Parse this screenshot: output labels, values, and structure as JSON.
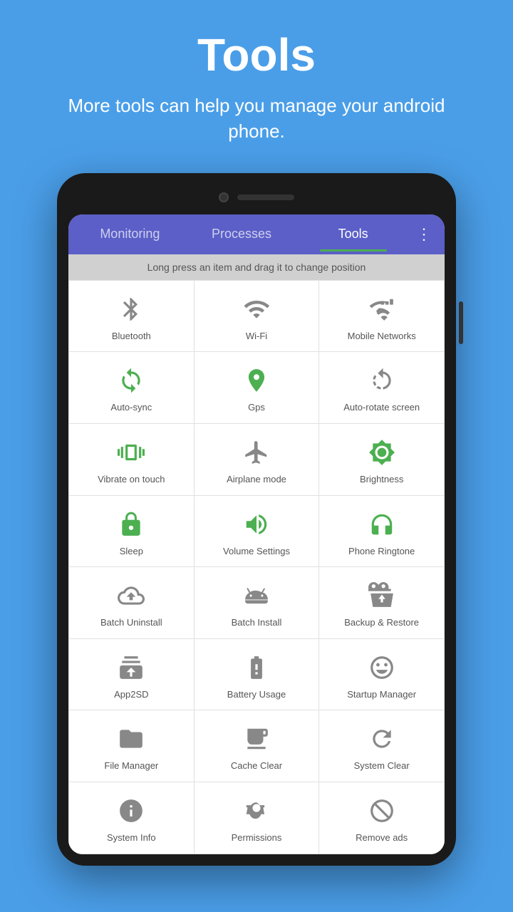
{
  "header": {
    "title": "Tools",
    "subtitle": "More tools can help you manage your android phone."
  },
  "tabs": {
    "items": [
      {
        "label": "Monitoring",
        "active": false
      },
      {
        "label": "Processes",
        "active": false
      },
      {
        "label": "Tools",
        "active": true
      }
    ],
    "more_icon": "⋮"
  },
  "hint": {
    "text": "Long press an item and drag it to change position"
  },
  "tools": [
    {
      "id": "bluetooth",
      "label": "Bluetooth",
      "color": "gray"
    },
    {
      "id": "wifi",
      "label": "Wi-Fi",
      "color": "gray"
    },
    {
      "id": "mobile-networks",
      "label": "Mobile Networks",
      "color": "gray"
    },
    {
      "id": "auto-sync",
      "label": "Auto-sync",
      "color": "green"
    },
    {
      "id": "gps",
      "label": "Gps",
      "color": "green"
    },
    {
      "id": "auto-rotate",
      "label": "Auto-rotate screen",
      "color": "gray"
    },
    {
      "id": "vibrate",
      "label": "Vibrate on touch",
      "color": "green"
    },
    {
      "id": "airplane",
      "label": "Airplane mode",
      "color": "gray"
    },
    {
      "id": "brightness",
      "label": "Brightness",
      "color": "green"
    },
    {
      "id": "sleep",
      "label": "Sleep",
      "color": "green"
    },
    {
      "id": "volume",
      "label": "Volume Settings",
      "color": "green"
    },
    {
      "id": "ringtone",
      "label": "Phone Ringtone",
      "color": "green"
    },
    {
      "id": "batch-uninstall",
      "label": "Batch Uninstall",
      "color": "gray"
    },
    {
      "id": "batch-install",
      "label": "Batch Install",
      "color": "gray"
    },
    {
      "id": "backup",
      "label": "Backup & Restore",
      "color": "gray"
    },
    {
      "id": "app2sd",
      "label": "App2SD",
      "color": "gray"
    },
    {
      "id": "battery",
      "label": "Battery Usage",
      "color": "gray"
    },
    {
      "id": "startup",
      "label": "Startup Manager",
      "color": "gray"
    },
    {
      "id": "file",
      "label": "File Manager",
      "color": "gray"
    },
    {
      "id": "cache",
      "label": "Cache Clear",
      "color": "gray"
    },
    {
      "id": "system-clear",
      "label": "System Clear",
      "color": "gray"
    },
    {
      "id": "system-info",
      "label": "System Info",
      "color": "gray"
    },
    {
      "id": "permissions",
      "label": "Permissions",
      "color": "gray"
    },
    {
      "id": "remove-ads",
      "label": "Remove ads",
      "color": "gray"
    }
  ]
}
